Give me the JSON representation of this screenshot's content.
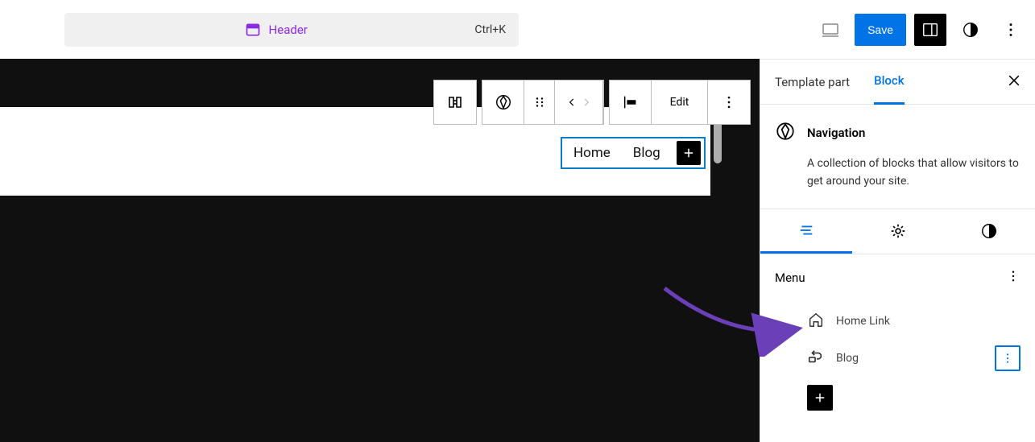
{
  "topbar": {
    "doc_label": "Header",
    "shortcut": "Ctrl+K",
    "save_label": "Save"
  },
  "toolbar": {
    "edit_label": "Edit"
  },
  "nav_block": {
    "links": [
      "Home",
      "Blog"
    ]
  },
  "sidebar": {
    "tabs": [
      "Template part",
      "Block"
    ],
    "active_tab": "Block",
    "block_title": "Navigation",
    "block_desc": "A collection of blocks that allow visitors to get around your site.",
    "menu_label": "Menu",
    "menu_items": [
      {
        "label": "Home Link",
        "icon": "home"
      },
      {
        "label": "Blog",
        "icon": "loop"
      }
    ]
  }
}
